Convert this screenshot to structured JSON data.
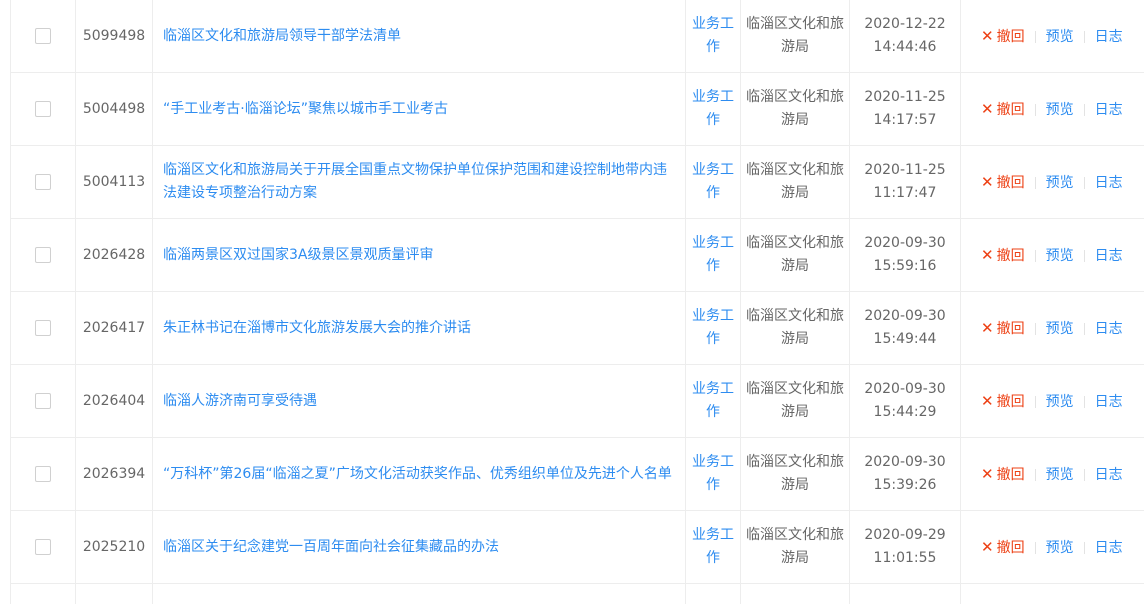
{
  "table": {
    "rows": [
      {
        "id": "5099498",
        "title": "临淄区文化和旅游局领导干部学法清单",
        "type": "业务工作",
        "org": "临淄区文化和旅游局",
        "date": "2020-12-22",
        "time": "14:44:46"
      },
      {
        "id": "5004498",
        "title": "“手工业考古·临淄论坛”聚焦以城市手工业考古",
        "type": "业务工作",
        "org": "临淄区文化和旅游局",
        "date": "2020-11-25",
        "time": "14:17:57"
      },
      {
        "id": "5004113",
        "title": "临淄区文化和旅游局关于开展全国重点文物保护单位保护范围和建设控制地带内违法建设专项整治行动方案",
        "type": "业务工作",
        "org": "临淄区文化和旅游局",
        "date": "2020-11-25",
        "time": "11:17:47"
      },
      {
        "id": "2026428",
        "title": "临淄两景区双过国家3A级景区景观质量评审",
        "type": "业务工作",
        "org": "临淄区文化和旅游局",
        "date": "2020-09-30",
        "time": "15:59:16"
      },
      {
        "id": "2026417",
        "title": "朱正林书记在淄博市文化旅游发展大会的推介讲话",
        "type": "业务工作",
        "org": "临淄区文化和旅游局",
        "date": "2020-09-30",
        "time": "15:49:44"
      },
      {
        "id": "2026404",
        "title": "临淄人游济南可享受待遇",
        "type": "业务工作",
        "org": "临淄区文化和旅游局",
        "date": "2020-09-30",
        "time": "15:44:29"
      },
      {
        "id": "2026394",
        "title": "“万科杯”第26届“临淄之夏”广场文化活动获奖作品、优秀组织单位及先进个人名单",
        "type": "业务工作",
        "org": "临淄区文化和旅游局",
        "date": "2020-09-30",
        "time": "15:39:26"
      },
      {
        "id": "2025210",
        "title": "临淄区关于纪念建党一百周年面向社会征集藏品的办法",
        "type": "业务工作",
        "org": "临淄区文化和旅游局",
        "date": "2020-09-29",
        "time": "11:01:55"
      }
    ],
    "actions": {
      "revoke": "撤回",
      "preview": "预览",
      "log": "日志"
    }
  },
  "colors": {
    "link": "#2d8cf0",
    "revoke": "#ed4014",
    "text": "#666666",
    "border": "#ededed"
  },
  "icons": {
    "revoke": "close-icon"
  }
}
